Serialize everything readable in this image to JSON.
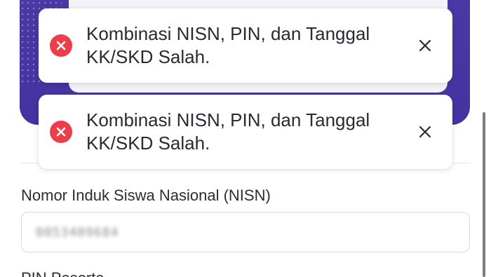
{
  "colors": {
    "hero": "#4b3aa6",
    "error_icon": "#ec3d4b",
    "text": "#2a2a33"
  },
  "toasts": [
    {
      "message": "Kombinasi NISN, PIN, dan Tanggal KK/SKD Salah.",
      "icon": "error-x-icon",
      "close_icon": "close-icon"
    },
    {
      "message": "Kombinasi NISN, PIN, dan Tanggal KK/SKD Salah.",
      "icon": "error-x-icon",
      "close_icon": "close-icon"
    }
  ],
  "form": {
    "nisn_label": "Nomor Induk Siswa Nasional (NISN)",
    "nisn_value": "0053409684",
    "pin_label": "PIN Peserta"
  }
}
